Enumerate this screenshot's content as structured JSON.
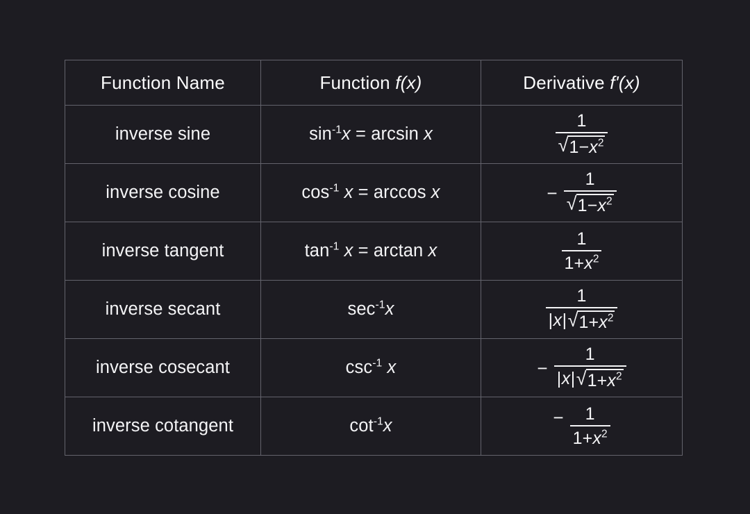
{
  "theme": {
    "background": "#1d1c22",
    "border": "#63636c",
    "text": "#f4f4f6"
  },
  "table": {
    "headers": [
      {
        "text_plain": "Function Name",
        "lead": "Function Name",
        "ital": ""
      },
      {
        "text_plain": "Function f(x)",
        "lead": "Function ",
        "ital": "f(x)"
      },
      {
        "text_plain": "Derivative f'(x)",
        "lead": "Derivative ",
        "ital": "f'(x)"
      }
    ],
    "rows": [
      {
        "name": "inverse sine",
        "function": {
          "base": "sin",
          "exponent": "-1",
          "after_exp": "x",
          "equals": " = ",
          "alt": "arcsin x",
          "text_plain": "sin-1x = arcsin x"
        },
        "derivative": {
          "text_plain": "1 / sqrt(1-x^2)",
          "sign": "",
          "sign_align": "mid",
          "numerator": "1",
          "denominator_radical": true,
          "denominator_prefix": "",
          "radicand_base": "1−x",
          "radicand_exponent": "2",
          "denominator_plain": "√(1−x²)"
        }
      },
      {
        "name": "inverse cosine",
        "function": {
          "base": "cos",
          "exponent": "-1",
          "after_exp": " x",
          "equals": " = ",
          "alt": "arccos x",
          "text_plain": "cos-1 x = arccos x"
        },
        "derivative": {
          "text_plain": "- 1 / sqrt(1-x^2)",
          "sign": "−",
          "sign_align": "mid",
          "numerator": "1",
          "denominator_radical": true,
          "denominator_prefix": "",
          "radicand_base": "1−x",
          "radicand_exponent": "2",
          "denominator_plain": "√(1−x²)"
        }
      },
      {
        "name": "inverse tangent",
        "function": {
          "base": "tan",
          "exponent": "-1",
          "after_exp": " x",
          "equals": " = ",
          "alt": "arctan x",
          "text_plain": "tan-1 x = arctan x"
        },
        "derivative": {
          "text_plain": "1 / (1+x^2)",
          "sign": "",
          "sign_align": "mid",
          "numerator": "1",
          "denominator_radical": false,
          "denominator_prefix": "",
          "radicand_base": "1+x",
          "radicand_exponent": "2",
          "denominator_plain": "1+x²"
        }
      },
      {
        "name": "inverse secant",
        "function": {
          "base": "sec",
          "exponent": "-1",
          "after_exp": "x",
          "equals": "",
          "alt": "",
          "text_plain": "sec-1x"
        },
        "derivative": {
          "text_plain": "1 / (|x| sqrt(1+x^2))",
          "sign": "",
          "sign_align": "mid",
          "numerator": "1",
          "denominator_radical": true,
          "denominator_prefix": "|x|",
          "radicand_base": "1+x",
          "radicand_exponent": "2",
          "denominator_plain": "|x|√(1+x²)"
        }
      },
      {
        "name": "inverse cosecant",
        "function": {
          "base": "csc",
          "exponent": "-1",
          "after_exp": " x",
          "equals": "",
          "alt": "",
          "text_plain": "csc-1 x"
        },
        "derivative": {
          "text_plain": "- 1 / (|x| sqrt(1+x^2))",
          "sign": "−",
          "sign_align": "mid",
          "numerator": "1",
          "denominator_radical": true,
          "denominator_prefix": "|x|",
          "radicand_base": "1+x",
          "radicand_exponent": "2",
          "denominator_plain": "|x|√(1+x²)"
        }
      },
      {
        "name": "inverse cotangent",
        "function": {
          "base": "cot",
          "exponent": "-1",
          "after_exp": "x",
          "equals": "",
          "alt": "",
          "text_plain": "cot-1x"
        },
        "derivative": {
          "text_plain": "- 1 / (1+x^2)",
          "sign": "−",
          "sign_align": "high",
          "numerator": "1",
          "denominator_radical": false,
          "denominator_prefix": "",
          "radicand_base": "1+x",
          "radicand_exponent": "2",
          "denominator_plain": "1+x²"
        }
      }
    ]
  },
  "glyphs": {
    "surd": "√"
  }
}
